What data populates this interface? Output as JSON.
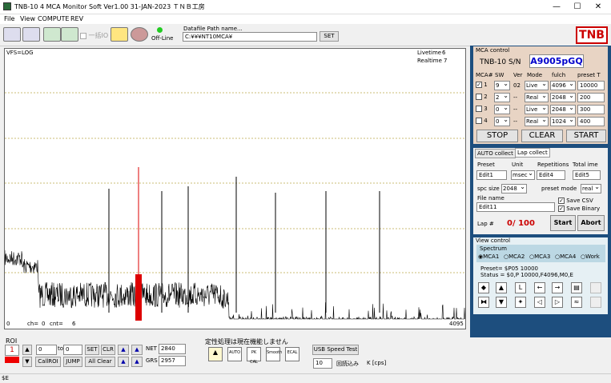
{
  "window": {
    "title": "TNB-10 4 MCA Monitor Soft Ver1.00 31-JAN-2023 ＴＮＢ工房"
  },
  "menu": [
    "File",
    "View",
    "COMPUTE",
    "REV"
  ],
  "toolbar": {
    "ikkatsu_label": "一括IO",
    "offline_label": "Off-Line",
    "path_label": "Datafile Path name...",
    "path_value": "C:¥¥¥NT10MCA¥",
    "set_label": "SET"
  },
  "brand": "TNB",
  "plot": {
    "vfs_label": "VFS=LOG",
    "livetime_label": "Livetime",
    "livetime_value": "6",
    "realtime_label": "Realtime",
    "realtime_value": "7",
    "x_min_label": "0",
    "x_max_label": "4095",
    "ch_label": "ch=",
    "ch_value": "0",
    "cnt_label": "cnt=",
    "cnt_value": "6"
  },
  "mca_control": {
    "title": "MCA control",
    "sn_label": "TNB-10 S/N",
    "sn_value": "A9005pGQ",
    "headers": [
      "MCA#",
      "SW",
      "Ver",
      "Mode",
      "fulch",
      "preset T"
    ],
    "rows": [
      {
        "num": "1",
        "checked": true,
        "sw": "9",
        "ver": "02",
        "mode": "Live",
        "fulch": "4096",
        "preset": "10000"
      },
      {
        "num": "2",
        "checked": false,
        "sw": "2",
        "ver": "--",
        "mode": "Real",
        "fulch": "2048",
        "preset": "200"
      },
      {
        "num": "3",
        "checked": false,
        "sw": "0",
        "ver": "--",
        "mode": "Live",
        "fulch": "2048",
        "preset": "300"
      },
      {
        "num": "4",
        "checked": false,
        "sw": "0",
        "ver": "--",
        "mode": "Real",
        "fulch": "1024",
        "preset": "400"
      }
    ],
    "stop": "STOP",
    "clear": "CLEAR",
    "start": "START"
  },
  "collect": {
    "tab_auto": "AUTO collect",
    "tab_lap": "Lap collect",
    "preset_label": "Preset",
    "unit_label": "Unit",
    "repetitions_label": "Repetitions",
    "total_label": "Total ime",
    "preset_value": "Edit1",
    "unit_value": "msec",
    "rep_value": "Edit4",
    "total_value": "Edit5",
    "spc_label": "spc size",
    "spc_value": "2048",
    "preset_mode_label": "preset mode",
    "preset_mode_value": "real",
    "file_label": "File name",
    "file_value": "Edit11",
    "save_csv": "Save CSV",
    "save_binary": "Save Binary",
    "lap_label": "Lap #",
    "lap_value": "0/  100",
    "start": "Start",
    "abort": "Abort"
  },
  "view": {
    "title": "View control",
    "spectrum_label": "Spectrum",
    "radios": [
      "MCA1",
      "MCA2",
      "MCA3",
      "MCA4",
      "Work"
    ],
    "preset_line": "Preset=   $P05  10000",
    "status_line": "Status =   $0,P  10000,F4096,M0,E"
  },
  "roi": {
    "label": "ROI",
    "roi_num": "1",
    "from_value": "0",
    "to_label": "to",
    "to_value": "0",
    "set": "SET",
    "clr": "CLR",
    "net_label": "NET",
    "net_value": "2840",
    "grs_label": "GRS",
    "grs_value": "2957",
    "callroi": "CallROI",
    "jump": "JUMP",
    "allclear": "All Clear"
  },
  "bottom": {
    "notice": "定性処理は現在機能しません",
    "auto": "AUTO",
    "pkcal": "PK CAL",
    "smooth": "Smooth",
    "ecal": "ECAL",
    "usb": "USB Speed Test",
    "speed_value": "10",
    "speed_label": "回読込み",
    "kcps": "K [cps]"
  },
  "status_bar": "$E",
  "colors": {
    "accent": "#1d4e7e",
    "marker": "#dd0000",
    "sn": "#0000cc"
  }
}
